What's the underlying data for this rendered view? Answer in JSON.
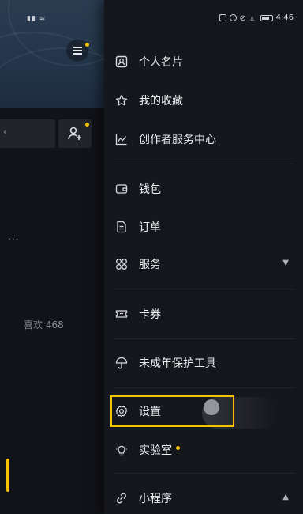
{
  "status": {
    "time": "4:46"
  },
  "background": {
    "likes_text": "喜欢 468",
    "ellipsis_text": "..."
  },
  "drawer": {
    "section1": [
      {
        "label": "个人名片",
        "icon": "person-card-icon"
      },
      {
        "label": "我的收藏",
        "icon": "star-icon"
      },
      {
        "label": "创作者服务中心",
        "icon": "chart-line-icon"
      }
    ],
    "section2": [
      {
        "label": "钱包",
        "icon": "wallet-icon"
      },
      {
        "label": "订单",
        "icon": "order-doc-icon"
      },
      {
        "label": "服务",
        "icon": "grid-services-icon",
        "arrow": "▼"
      }
    ],
    "section3": [
      {
        "label": "卡券",
        "icon": "ticket-icon"
      }
    ],
    "section4": [
      {
        "label": "未成年保护工具",
        "icon": "umbrella-icon"
      }
    ],
    "section5": [
      {
        "label": "设置",
        "icon": "gear-icon"
      },
      {
        "label": "实验室",
        "icon": "lightbulb-icon"
      },
      {
        "label": "小程序",
        "icon": "link-icon",
        "arrow": "▲"
      }
    ]
  },
  "colors": {
    "accent": "#f5c200",
    "drawer_bg": "#16171d"
  }
}
